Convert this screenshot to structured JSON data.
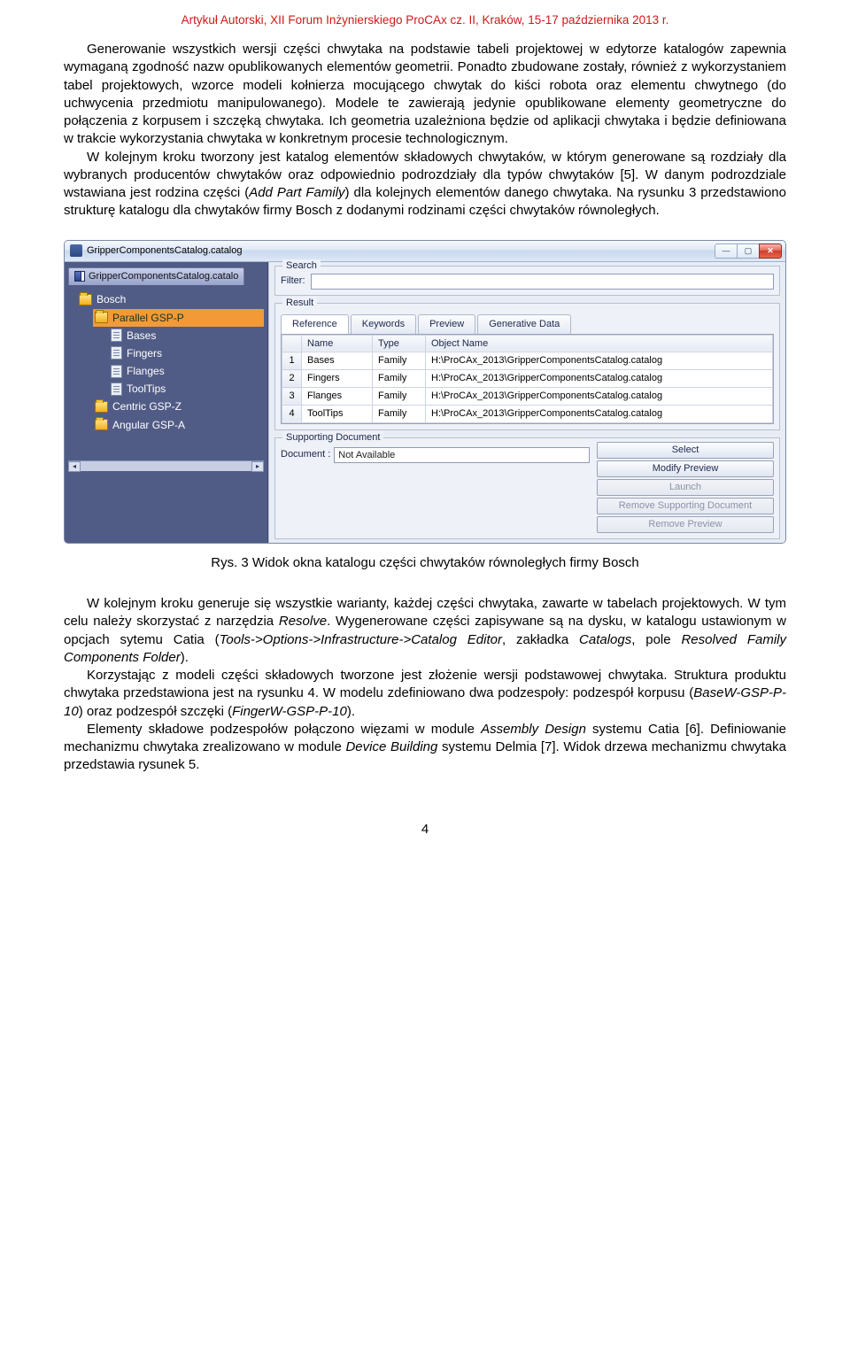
{
  "header": "Artykuł Autorski, XII Forum Inżynierskiego ProCAx cz. II, Kraków, 15-17 października 2013 r.",
  "para1": "Generowanie wszystkich wersji części chwytaka na podstawie tabeli projektowej w edytorze katalogów zapewnia wymaganą zgodność nazw opublikowanych elementów geometrii. Ponadto zbudowane zostały, również z wykorzystaniem tabel projektowych, wzorce modeli kołnierza mocującego chwytak do kiści robota oraz elementu chwytnego (do uchwycenia przedmiotu manipulowanego). Modele te zawierają jedynie opublikowane elementy geometryczne do połączenia z korpusem i szczęką chwytaka. Ich geometria uzależniona będzie od aplikacji chwytaka i będzie definiowana w trakcie wykorzystania chwytaka w konkretnym procesie technologicznym.",
  "para2a": "W kolejnym kroku tworzony jest katalog elementów składowych chwytaków, w którym generowane są rozdziały dla wybranych producentów chwytaków oraz odpowiednio podrozdziały dla typów chwytaków [5]. W danym podrozdziale wstawiana jest rodzina części (",
  "para2_addpart": "Add Part Family",
  "para2b": ") dla kolejnych elementów danego chwytaka. Na rysunku 3 przedstawiono strukturę katalogu dla chwytaków firmy Bosch z dodanymi rodzinami części chwytaków równoległych.",
  "window": {
    "title": "GripperComponentsCatalog.catalog",
    "tree_tab": "GripperComponentsCatalog.catalo",
    "tree": {
      "bosch": "Bosch",
      "parallel": "Parallel GSP-P",
      "bases": "Bases",
      "fingers": "Fingers",
      "flanges": "Flanges",
      "tooltips": "ToolTips",
      "centric": "Centric GSP-Z",
      "angular": "Angular GSP-A"
    },
    "search": {
      "title": "Search",
      "filter_label": "Filter:"
    },
    "result": {
      "title": "Result",
      "tabs": [
        "Reference",
        "Keywords",
        "Preview",
        "Generative Data"
      ],
      "columns": [
        "",
        "Name",
        "Type",
        "Object Name"
      ],
      "rows": [
        {
          "n": "1",
          "name": "Bases",
          "type": "Family",
          "obj": "H:\\ProCAx_2013\\GripperComponentsCatalog.catalog"
        },
        {
          "n": "2",
          "name": "Fingers",
          "type": "Family",
          "obj": "H:\\ProCAx_2013\\GripperComponentsCatalog.catalog"
        },
        {
          "n": "3",
          "name": "Flanges",
          "type": "Family",
          "obj": "H:\\ProCAx_2013\\GripperComponentsCatalog.catalog"
        },
        {
          "n": "4",
          "name": "ToolTips",
          "type": "Family",
          "obj": "H:\\ProCAx_2013\\GripperComponentsCatalog.catalog"
        }
      ]
    },
    "supporting": {
      "title": "Supporting Document",
      "doc_label": "Document :",
      "doc_value": "Not Available",
      "buttons": {
        "select": "Select",
        "modify": "Modify Preview",
        "launch": "Launch",
        "remove_doc": "Remove Supporting Document",
        "remove_prev": "Remove Preview"
      }
    }
  },
  "caption": "Rys. 3 Widok okna katalogu części chwytaków równoległych firmy Bosch",
  "para3a": "W kolejnym kroku generuje się wszystkie warianty, każdej części chwytaka, zawarte w tabelach projektowych. W tym celu należy skorzystać z narzędzia ",
  "para3_resolve": "Resolve",
  "para3b": ". Wygenerowane części zapisywane są na dysku, w katalogu ustawionym w opcjach sytemu Catia (",
  "para3_tools": "Tools->Options->Infrastructure->Catalog Editor",
  "para3c": ", zakładka ",
  "para3_catalogs": "Catalogs",
  "para3d": ", pole ",
  "para3_resolved": "Resolved Family Components Folder",
  "para3e": ").",
  "para4a": "Korzystając z modeli części składowych tworzone jest złożenie wersji podstawowej chwytaka. Struktura produktu chwytaka przedstawiona jest na rysunku 4. W modelu zdefiniowano dwa podzespoły: podzespół korpusu (",
  "para4_base": "BaseW-GSP-P-10",
  "para4b": ") oraz podzespół szczęki (",
  "para4_finger": "FingerW-GSP-P-10",
  "para4c": ").",
  "para5a": "Elementy składowe podzespołów połączono więzami w module ",
  "para5_asm": "Assembly Design",
  "para5b": " systemu Catia [6]. Definiowanie mechanizmu chwytaka zrealizowano w module ",
  "para5_dev": "Device Building",
  "para5c": " systemu Delmia [7]. Widok drzewa mechanizmu chwytaka przedstawia rysunek 5.",
  "page_number": "4"
}
